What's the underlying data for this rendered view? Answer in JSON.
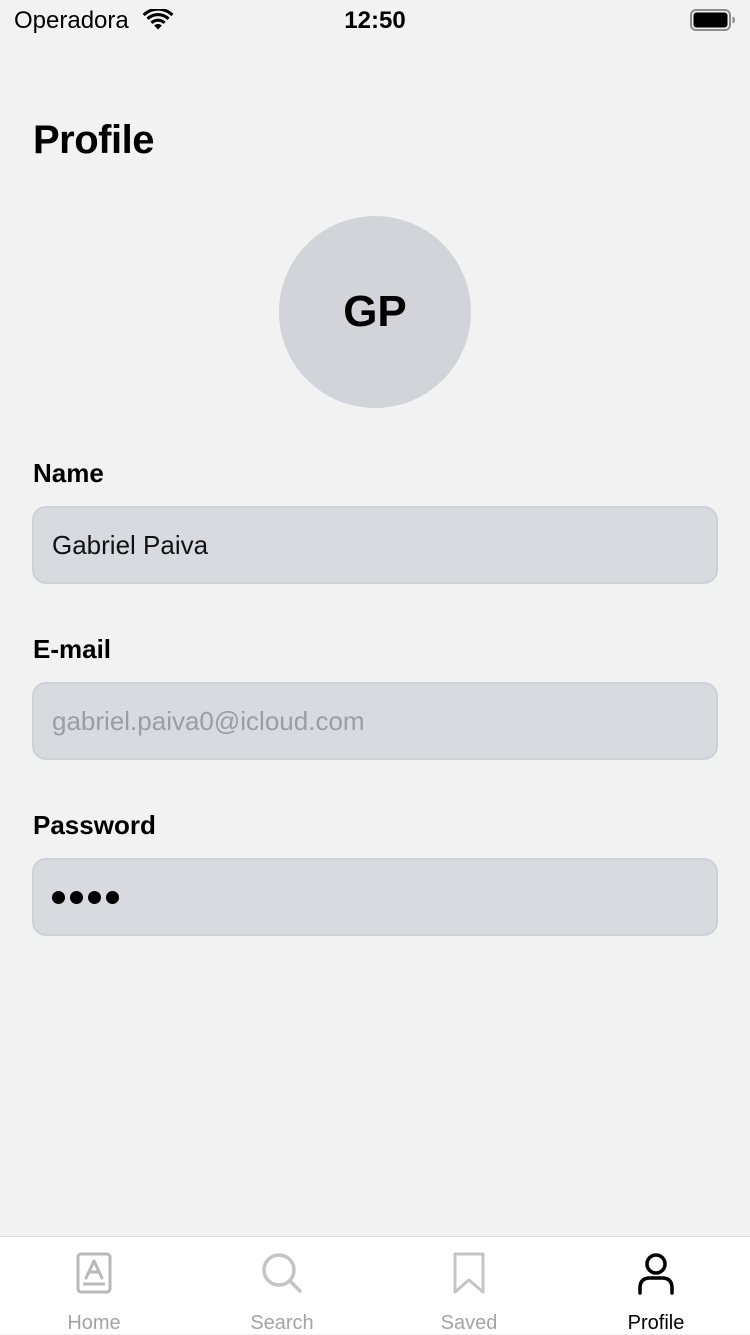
{
  "status_bar": {
    "carrier": "Operadora",
    "time": "12:50"
  },
  "page": {
    "title": "Profile"
  },
  "avatar": {
    "initials": "GP"
  },
  "form": {
    "name": {
      "label": "Name",
      "value": "Gabriel Paiva"
    },
    "email": {
      "label": "E-mail",
      "value": "gabriel.paiva0@icloud.com"
    },
    "password": {
      "label": "Password",
      "masked_length": 4
    }
  },
  "tab_bar": {
    "active_tab": "Profile",
    "tabs": [
      {
        "label": "Home",
        "icon": "book-icon"
      },
      {
        "label": "Search",
        "icon": "search-icon"
      },
      {
        "label": "Saved",
        "icon": "bookmark-icon"
      },
      {
        "label": "Profile",
        "icon": "person-icon"
      }
    ]
  },
  "colors": {
    "background": "#f2f2f2",
    "avatar_bg": "#d2d4da",
    "field_bg": "#d8dadf",
    "inactive_tab": "#a3a3a8",
    "active_tab": "#000000"
  }
}
